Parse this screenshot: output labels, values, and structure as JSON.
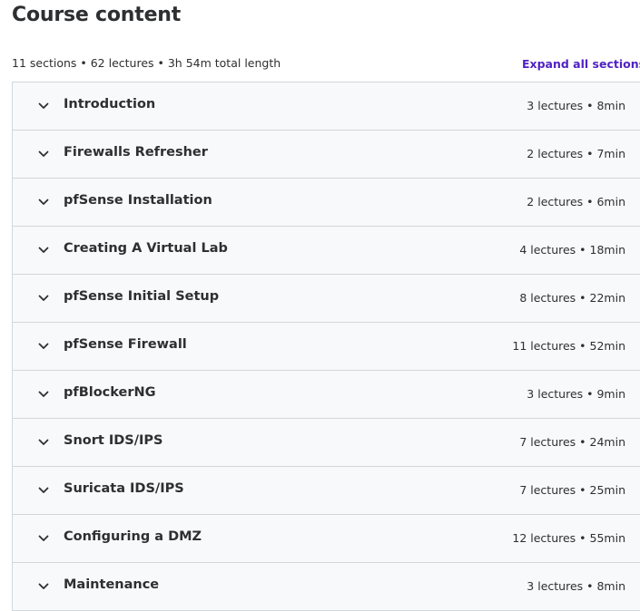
{
  "header": {
    "title": "Course content",
    "summary": "11 sections • 62 lectures • 3h 54m total length",
    "expand_all_label": "Expand all sections"
  },
  "colors": {
    "accent": "#5022c3",
    "row_background": "#f7f9fa",
    "border": "#d1d7dc",
    "text": "#2d2f31"
  },
  "sections": [
    {
      "title": "Introduction",
      "meta": "3 lectures • 8min",
      "icon": "chevron-down-icon"
    },
    {
      "title": "Firewalls Refresher",
      "meta": "2 lectures • 7min",
      "icon": "chevron-down-icon"
    },
    {
      "title": "pfSense Installation",
      "meta": "2 lectures • 6min",
      "icon": "chevron-down-icon"
    },
    {
      "title": "Creating A Virtual Lab",
      "meta": "4 lectures • 18min",
      "icon": "chevron-down-icon"
    },
    {
      "title": "pfSense Initial Setup",
      "meta": "8 lectures • 22min",
      "icon": "chevron-down-icon"
    },
    {
      "title": "pfSense Firewall",
      "meta": "11 lectures • 52min",
      "icon": "chevron-down-icon"
    },
    {
      "title": "pfBlockerNG",
      "meta": "3 lectures • 9min",
      "icon": "chevron-down-icon"
    },
    {
      "title": "Snort IDS/IPS",
      "meta": "7 lectures • 24min",
      "icon": "chevron-down-icon"
    },
    {
      "title": "Suricata IDS/IPS",
      "meta": "7 lectures • 25min",
      "icon": "chevron-down-icon"
    },
    {
      "title": "Configuring a DMZ",
      "meta": "12 lectures • 55min",
      "icon": "chevron-down-icon"
    },
    {
      "title": "Maintenance",
      "meta": "3 lectures • 8min",
      "icon": "chevron-down-icon"
    }
  ]
}
